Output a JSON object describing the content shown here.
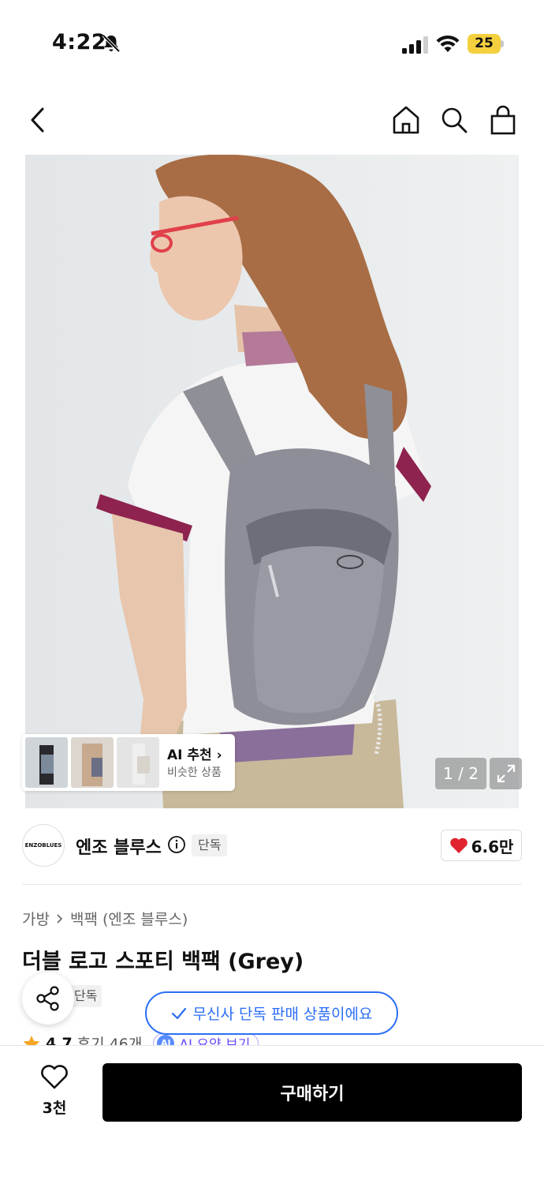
{
  "status_bar": {
    "time": "4:22",
    "battery": "25"
  },
  "ai_recommend": {
    "title": "AI 추천",
    "subtitle": "비슷한 상품"
  },
  "image_counter": "1 / 2",
  "brand": {
    "logo_text": "ENZOBLUES",
    "name": "엔조 블루스",
    "exclusive": "단독",
    "likes": "6.6만"
  },
  "breadcrumb": {
    "category": "가방",
    "subcategory": "백팩 (엔조 블루스)"
  },
  "product": {
    "title": "더블 로고 스포티 백팩 (Grey)",
    "partial_tag": "단독"
  },
  "toast": "무신사 단독 판매 상품이에요",
  "rating": {
    "value": "4.7",
    "reviews": "후기 46개",
    "ai_chip": "AI 요약 보기",
    "ai_badge": "AI"
  },
  "bottom_bar": {
    "wish_count": "3천",
    "buy_label": "구매하기"
  },
  "colors": {
    "accent_blue": "#2b6ef6",
    "heart_red": "#e0242f",
    "battery_yellow": "#f4d03f"
  }
}
